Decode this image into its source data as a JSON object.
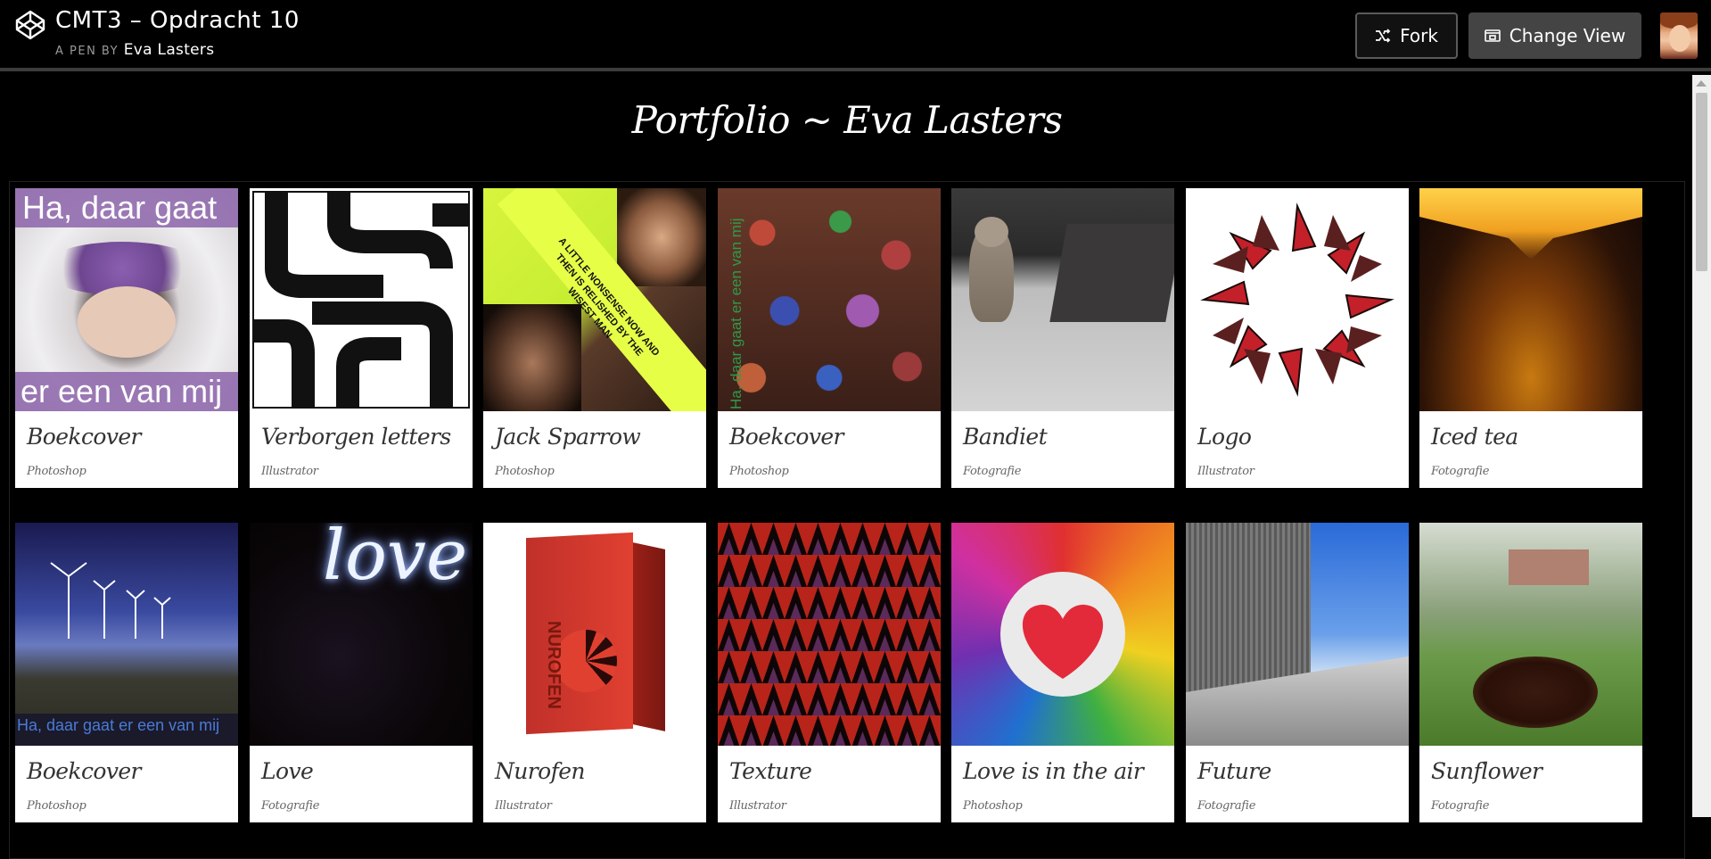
{
  "header": {
    "title": "CMT3 – Opdracht 10",
    "byline_prefix": "A PEN BY",
    "author": "Eva Lasters",
    "fork_label": "Fork",
    "change_view_label": "Change View"
  },
  "page": {
    "heading": "Portfolio ~ Eva Lasters"
  },
  "cards": [
    {
      "title": "Boekcover",
      "category": "Photoshop",
      "overlay_top": "Ha, daar gaat",
      "overlay_bottom": "er een van mij"
    },
    {
      "title": "Verborgen letters",
      "category": "Illustrator"
    },
    {
      "title": "Jack Sparrow",
      "category": "Photoshop",
      "banner": "A LITTLE NONSENSE NOW AND THEN IS RELISHED BY THE WISEST MAN"
    },
    {
      "title": "Boekcover",
      "category": "Photoshop",
      "overlay_side": "Ha, daar gaat er een van mij"
    },
    {
      "title": "Bandiet",
      "category": "Fotografie"
    },
    {
      "title": "Logo",
      "category": "Illustrator"
    },
    {
      "title": "Iced tea",
      "category": "Fotografie"
    },
    {
      "title": "Boekcover",
      "category": "Photoshop",
      "overlay_bottom": "Ha, daar gaat er een van mij"
    },
    {
      "title": "Love",
      "category": "Fotografie",
      "light_text": "love"
    },
    {
      "title": "Nurofen",
      "category": "Illustrator",
      "box_text": "NUROFEN"
    },
    {
      "title": "Texture",
      "category": "Illustrator"
    },
    {
      "title": "Love is in the air",
      "category": "Photoshop"
    },
    {
      "title": "Future",
      "category": "Fotografie"
    },
    {
      "title": "Sunflower",
      "category": "Fotografie"
    }
  ]
}
